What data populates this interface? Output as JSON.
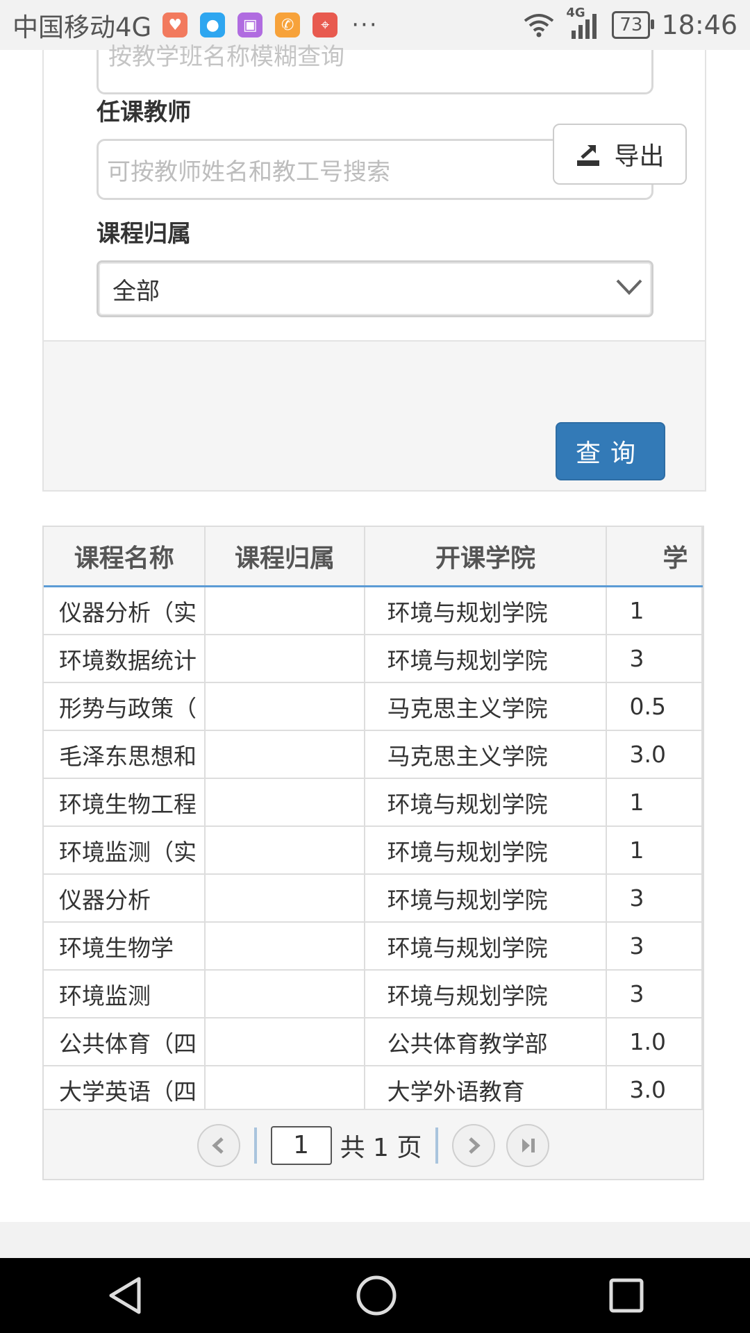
{
  "status_bar": {
    "carrier": "中国移动4G",
    "more": "···",
    "network": "4G",
    "battery": "73",
    "time": "18:46",
    "app_icons": [
      "health-app-icon",
      "message-app-icon",
      "gallery-app-icon",
      "call-app-icon",
      "map-app-icon"
    ]
  },
  "form": {
    "class_name_placeholder": "按教学班名称模糊查询",
    "teacher_label": "任课教师",
    "teacher_placeholder": "可按教师姓名和教工号搜索",
    "belong_label": "课程归属",
    "belong_value": "全部",
    "export_label": "导出",
    "query_label": "查询"
  },
  "table": {
    "headers": [
      "课程名称",
      "课程归属",
      "开课学院",
      "学"
    ],
    "rows": [
      {
        "name": "仪器分析（实",
        "belong": "",
        "college": "环境与规划学院",
        "credit": "1"
      },
      {
        "name": "环境数据统计",
        "belong": "",
        "college": "环境与规划学院",
        "credit": "3"
      },
      {
        "name": "形势与政策（",
        "belong": "",
        "college": "马克思主义学院",
        "credit": "0.5"
      },
      {
        "name": "毛泽东思想和",
        "belong": "",
        "college": "马克思主义学院",
        "credit": "3.0"
      },
      {
        "name": "环境生物工程",
        "belong": "",
        "college": "环境与规划学院",
        "credit": "1"
      },
      {
        "name": "环境监测（实",
        "belong": "",
        "college": "环境与规划学院",
        "credit": "1"
      },
      {
        "name": "仪器分析",
        "belong": "",
        "college": "环境与规划学院",
        "credit": "3"
      },
      {
        "name": "环境生物学",
        "belong": "",
        "college": "环境与规划学院",
        "credit": "3"
      },
      {
        "name": "环境监测",
        "belong": "",
        "college": "环境与规划学院",
        "credit": "3"
      },
      {
        "name": "公共体育（四",
        "belong": "",
        "college": "公共体育教学部",
        "credit": "1.0"
      },
      {
        "name": "大学英语（四",
        "belong": "",
        "college": "大学外语教育",
        "credit": "3.0"
      }
    ]
  },
  "pager": {
    "current": "1",
    "total_text": "共 1 页"
  }
}
